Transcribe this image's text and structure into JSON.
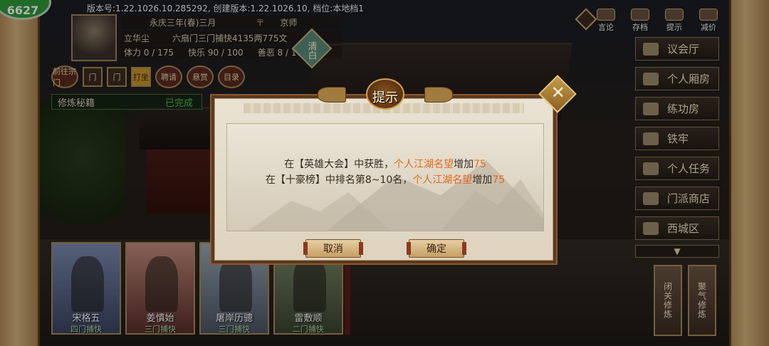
{
  "status": {
    "fps": "6627",
    "version_info": "版本号:1.22.1026.10.285292, 创建版本:1.22.1026.10, 档位:本地档1"
  },
  "character": {
    "era": "永庆三年(春)三月",
    "location_icon": "place-icon",
    "location": "京师",
    "name": "立华尘",
    "title": "六扇门三门捕快4135两775文",
    "stamina": "体力 0 / 175",
    "happiness": "快乐 90 / 100",
    "morality": "善恶 8 / 100",
    "trait": "清白"
  },
  "small_buttons": [
    "前往宗门",
    "门",
    "门",
    "打坐",
    "聘请",
    "悬赏",
    "目录"
  ],
  "cultivation": {
    "label": "修炼秘籍",
    "status": "已完成"
  },
  "top_icons": [
    "言论",
    "存档",
    "提示",
    "减价"
  ],
  "right_menu": [
    {
      "label": "议会厅",
      "icon": "hall-icon"
    },
    {
      "label": "个人厢房",
      "icon": "bed-icon"
    },
    {
      "label": "练功房",
      "icon": "training-icon"
    },
    {
      "label": "铁牢",
      "icon": "jail-icon"
    },
    {
      "label": "个人任务",
      "icon": "task-icon"
    },
    {
      "label": "门派商店",
      "icon": "shop-icon"
    },
    {
      "label": "西城区",
      "icon": "district-icon"
    }
  ],
  "side_buttons": [
    "闭关修炼",
    "聚气修炼"
  ],
  "disciples": [
    {
      "name": "宋格五",
      "rank": "四门捕快"
    },
    {
      "name": "姜慎始",
      "rank": "三门捕快"
    },
    {
      "name": "屠岸历骢",
      "rank": "三门捕快"
    },
    {
      "name": "雷敷顺",
      "rank": "二门捕快"
    }
  ],
  "dialog": {
    "title": "提示",
    "line1": {
      "pre": "在【英雄大会】中获胜，",
      "hl": "个人江湖名望",
      "mid": "增加",
      "num": "75"
    },
    "line2": {
      "pre": "在【十豪榜】中排名第8~10名，",
      "hl": "个人江湖名望",
      "mid": "增加",
      "num": "75"
    },
    "cancel_label": "取消",
    "confirm_label": "确定",
    "close_glyph": "✕"
  },
  "colors": {
    "highlight": "#e06a1e",
    "accent_gold": "#c9a36a"
  }
}
